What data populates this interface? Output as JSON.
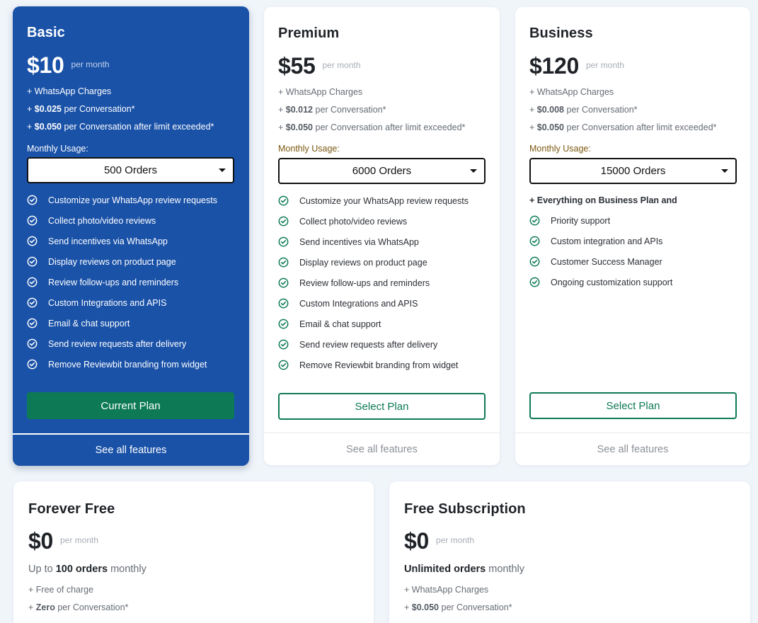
{
  "colors": {
    "featured_bg": "#1a52a8",
    "accent_green": "#0d7a55",
    "usage_label": "#7d5a12"
  },
  "plans": [
    {
      "name": "Basic",
      "price": "$10",
      "period": "per month",
      "charges": [
        {
          "pre": "+ ",
          "bold": "",
          "text": "WhatsApp Charges"
        },
        {
          "pre": "+ ",
          "bold": "$0.025",
          "text": " per Conversation*"
        },
        {
          "pre": "+ ",
          "bold": "$0.050",
          "text": " per Conversation after limit exceeded*"
        }
      ],
      "usage_label": "Monthly Usage:",
      "usage_value": "500 Orders",
      "features": [
        "Customize your WhatsApp review requests",
        "Collect photo/video reviews",
        "Send incentives via WhatsApp",
        "Display reviews on product page",
        "Review follow-ups and reminders",
        "Custom Integrations and APIS",
        "Email & chat support",
        "Send review requests after delivery",
        "Remove Reviewbit branding from widget"
      ],
      "button": "Current Plan",
      "see_all": "See all features"
    },
    {
      "name": "Premium",
      "price": "$55",
      "period": "per month",
      "charges": [
        {
          "pre": "+ ",
          "bold": "",
          "text": "WhatsApp Charges"
        },
        {
          "pre": "+ ",
          "bold": "$0.012",
          "text": " per Conversation*"
        },
        {
          "pre": "+ ",
          "bold": "$0.050",
          "text": " per Conversation after limit exceeded*"
        }
      ],
      "usage_label": "Monthly Usage:",
      "usage_value": "6000 Orders",
      "features": [
        "Customize your WhatsApp review requests",
        "Collect photo/video reviews",
        "Send incentives via WhatsApp",
        "Display reviews on product page",
        "Review follow-ups and reminders",
        "Custom Integrations and APIS",
        "Email & chat support",
        "Send review requests after delivery",
        "Remove Reviewbit branding from widget"
      ],
      "button": "Select Plan",
      "see_all": "See all features"
    },
    {
      "name": "Business",
      "price": "$120",
      "period": "per month",
      "charges": [
        {
          "pre": "+ ",
          "bold": "",
          "text": "WhatsApp Charges"
        },
        {
          "pre": "+ ",
          "bold": "$0.008",
          "text": " per Conversation*"
        },
        {
          "pre": "+ ",
          "bold": "$0.050",
          "text": " per Conversation after limit exceeded*"
        }
      ],
      "usage_label": "Monthly Usage:",
      "usage_value": "15000 Orders",
      "everything": "+ Everything on Business Plan and",
      "features": [
        "Priority support",
        "Custom integration and APIs",
        "Customer Success Manager",
        "Ongoing customization support"
      ],
      "button": "Select Plan",
      "see_all": "See all features"
    }
  ],
  "free_plans": [
    {
      "name": "Forever Free",
      "price": "$0",
      "period": "per month",
      "orders_pre": "Up to ",
      "orders_bold": "100 orders",
      "orders_post": " monthly",
      "charges": [
        {
          "pre": "+ ",
          "bold": "",
          "text": "Free of charge"
        },
        {
          "pre": "+ ",
          "bold": "Zero",
          "text": " per Conversation*"
        }
      ]
    },
    {
      "name": "Free Subscription",
      "price": "$0",
      "period": "per month",
      "orders_pre": "",
      "orders_bold": "Unlimited orders",
      "orders_post": " monthly",
      "charges": [
        {
          "pre": "+ ",
          "bold": "",
          "text": "WhatsApp Charges"
        },
        {
          "pre": "+ ",
          "bold": "$0.050",
          "text": " per Conversation*"
        }
      ]
    }
  ]
}
